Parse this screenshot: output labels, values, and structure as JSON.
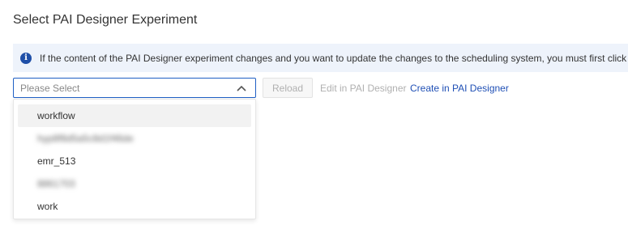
{
  "header": {
    "title": "Select PAI Designer Experiment"
  },
  "notice": {
    "icon": "info-icon",
    "text": "If the content of the PAI Designer experiment changes and you want to update the changes to the scheduling system, you must first click"
  },
  "select": {
    "placeholder": "Please Select",
    "expanded": true,
    "options": [
      "workflow",
      "hyp8f8d5a5c8d1f46de",
      "emr_513",
      "8861703",
      "work"
    ]
  },
  "actions": {
    "reload_label": "Reload",
    "edit_label": "Edit in PAI Designer",
    "create_label": "Create in PAI Designer"
  },
  "colors": {
    "accent": "#1f5fc4",
    "link": "#1f4fb5",
    "notice_bg": "#eef3fb",
    "disabled_text": "#b0b0b0"
  }
}
